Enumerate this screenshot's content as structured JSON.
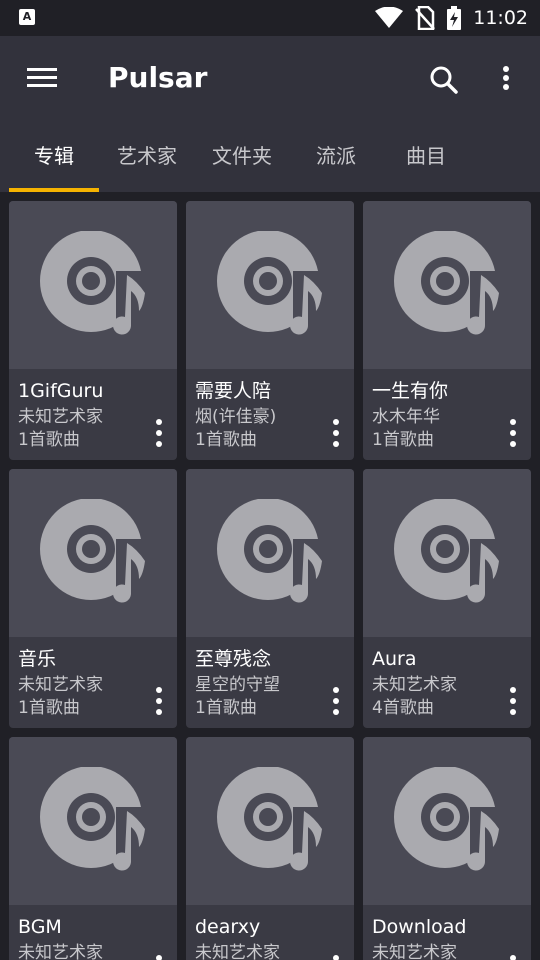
{
  "status_bar": {
    "notification_icon": "A",
    "time": "11:02",
    "icons": [
      "wifi-icon",
      "no-sim-icon",
      "battery-charging-icon"
    ]
  },
  "app_bar": {
    "title": "Pulsar",
    "menu_icon": "menu-icon",
    "search_icon": "search-icon",
    "more_icon": "more-vert-icon"
  },
  "tabs": [
    {
      "label": "专辑",
      "active": true
    },
    {
      "label": "艺术家",
      "active": false
    },
    {
      "label": "文件夹",
      "active": false
    },
    {
      "label": "流派",
      "active": false
    },
    {
      "label": "曲目",
      "active": false
    }
  ],
  "albums": [
    {
      "title": "1GifGuru",
      "artist": "未知艺术家",
      "count": "1首歌曲"
    },
    {
      "title": "需要人陪",
      "artist": "烟(许佳豪)",
      "count": "1首歌曲"
    },
    {
      "title": "一生有你",
      "artist": "水木年华",
      "count": "1首歌曲"
    },
    {
      "title": "音乐",
      "artist": "未知艺术家",
      "count": "1首歌曲"
    },
    {
      "title": "至尊残念",
      "artist": "星空的守望",
      "count": "1首歌曲"
    },
    {
      "title": "Aura",
      "artist": "未知艺术家",
      "count": "4首歌曲"
    },
    {
      "title": "BGM",
      "artist": "未知艺术家",
      "count": ""
    },
    {
      "title": "dearxy",
      "artist": "未知艺术家",
      "count": ""
    },
    {
      "title": "Download",
      "artist": "未知艺术家",
      "count": ""
    }
  ],
  "colors": {
    "background": "#202026",
    "app_bar": "#32323c",
    "card": "#3a3a44",
    "art": "#4a4a55",
    "accent": "#f5b301",
    "album_icon": "#aaaaaf"
  }
}
